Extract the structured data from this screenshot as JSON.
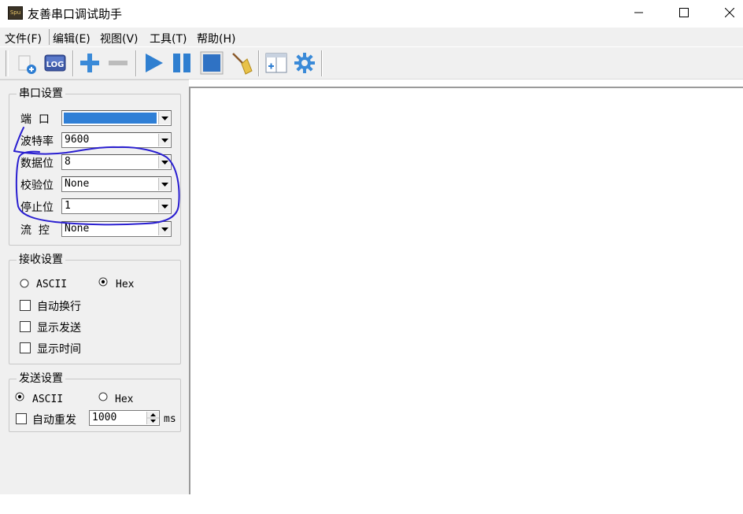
{
  "window": {
    "title": "友善串口调试助手",
    "icon_text": "Spu"
  },
  "menu": [
    "文件(F)",
    "编辑(E)",
    "视图(V)",
    "工具(T)",
    "帮助(H)"
  ],
  "toolbar": {
    "buttons": [
      "new-connection-icon",
      "log-icon",
      "add-icon",
      "remove-icon",
      "play-icon",
      "pause-icon",
      "stop-icon",
      "clear-broom-icon",
      "add-window-icon",
      "settings-gear-icon"
    ],
    "log_label": "LOG",
    "accent": "#2d7dd2"
  },
  "serial_settings": {
    "title": "串口设置",
    "port_label": "端  口",
    "port_value": "",
    "baud_label": "波特率",
    "baud_value": "9600",
    "databits_label": "数据位",
    "databits_value": "8",
    "parity_label": "校验位",
    "parity_value": "None",
    "stopbits_label": "停止位",
    "stopbits_value": "1",
    "flow_label": "流  控",
    "flow_value": "None"
  },
  "receive_settings": {
    "title": "接收设置",
    "ascii_label": "ASCII",
    "hex_label": "Hex",
    "selected": "Hex",
    "auto_wrap_label": "自动换行",
    "show_send_label": "显示发送",
    "show_time_label": "显示时间"
  },
  "send_settings": {
    "title": "发送设置",
    "ascii_label": "ASCII",
    "hex_label": "Hex",
    "selected": "ASCII",
    "auto_resend_label": "自动重发",
    "interval_value": "1000",
    "interval_unit": "ms"
  },
  "annotation": {
    "color": "#2a1fd0"
  }
}
